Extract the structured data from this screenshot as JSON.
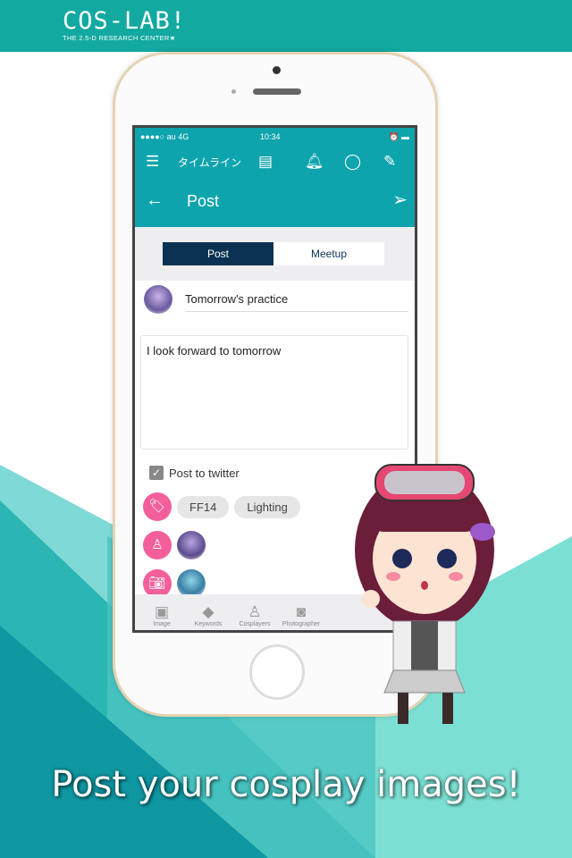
{
  "brand": {
    "logo": "COS-LAB!",
    "tagline": "THE 2.5-D RESEARCH CENTER★",
    "colors": {
      "teal": "#12a9a0",
      "pink": "#f35f9a",
      "navy": "#0b3252"
    }
  },
  "status_bar": {
    "carrier": "●●●●○ au  4G",
    "time": "10:34",
    "right": "⏰ ▬"
  },
  "nav": {
    "timeline": "タイムライン",
    "icons": [
      "menu-icon",
      "notebook-icon",
      "bell-icon",
      "chat-icon",
      "compose-icon"
    ]
  },
  "header": {
    "title": "Post"
  },
  "segments": {
    "post": "Post",
    "meetup": "Meetup"
  },
  "form": {
    "subject": "Tomorrow's practice",
    "body": "I look forward to tomorrow",
    "twitter_label": "Post to twitter",
    "twitter_checked": true
  },
  "keywords": [
    "FF14",
    "Lighting"
  ],
  "tabs": [
    "Image",
    "Keywords",
    "Cosplayers",
    "Photographer"
  ],
  "caption": "Post your cosplay images!"
}
